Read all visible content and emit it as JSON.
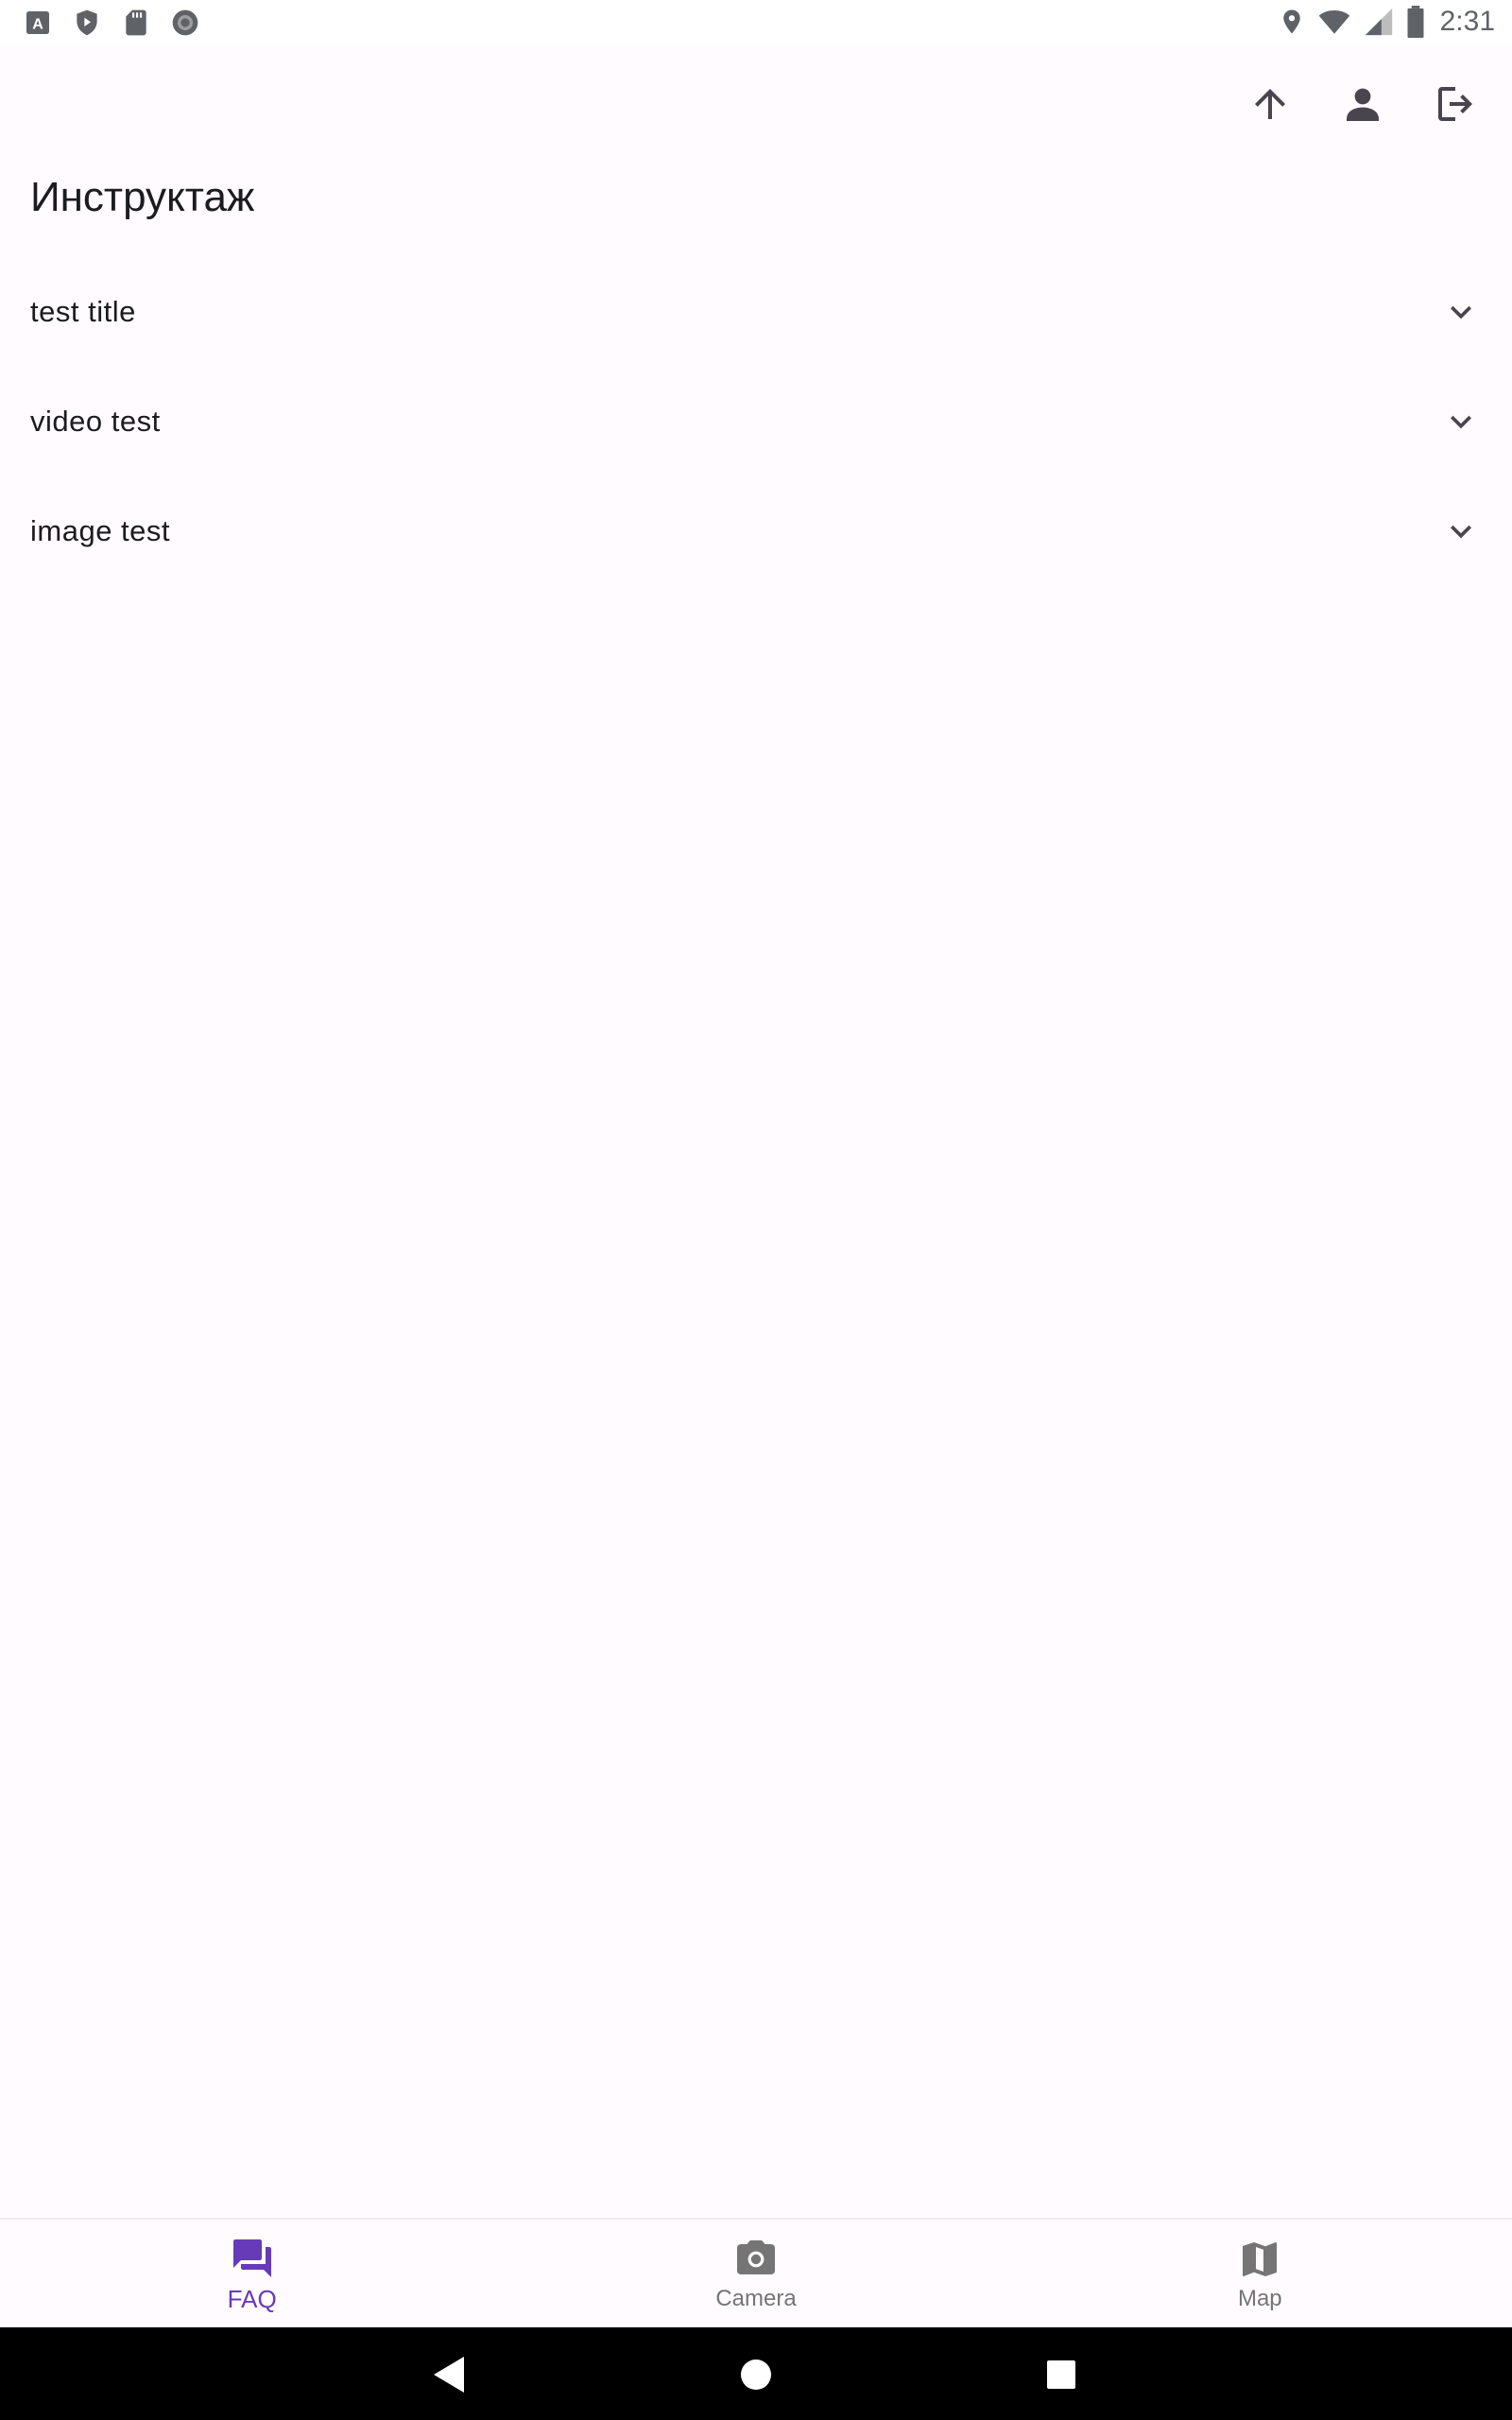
{
  "status_bar": {
    "time": "2:31",
    "left_icons": [
      "app-a-icon",
      "shield-play-icon",
      "sd-card-icon",
      "record-icon"
    ],
    "right_icons": [
      "location-icon",
      "wifi-icon",
      "signal-icon",
      "battery-icon"
    ]
  },
  "app_bar": {
    "actions": [
      {
        "name": "upload-button",
        "icon": "arrow-up-icon"
      },
      {
        "name": "profile-button",
        "icon": "person-icon"
      },
      {
        "name": "logout-button",
        "icon": "logout-icon"
      }
    ]
  },
  "page": {
    "title": "Инструктаж"
  },
  "faq": {
    "items": [
      {
        "label": "test title"
      },
      {
        "label": "video test"
      },
      {
        "label": "image test"
      }
    ]
  },
  "bottom_nav": {
    "items": [
      {
        "label": "FAQ",
        "icon": "forum-icon",
        "active": true
      },
      {
        "label": "Camera",
        "icon": "camera-icon",
        "active": false
      },
      {
        "label": "Map",
        "icon": "map-icon",
        "active": false
      }
    ],
    "active_color": "#673AB7",
    "inactive_color": "#757575"
  },
  "system_nav": {
    "buttons": [
      "back-icon",
      "home-icon",
      "recents-icon"
    ]
  }
}
